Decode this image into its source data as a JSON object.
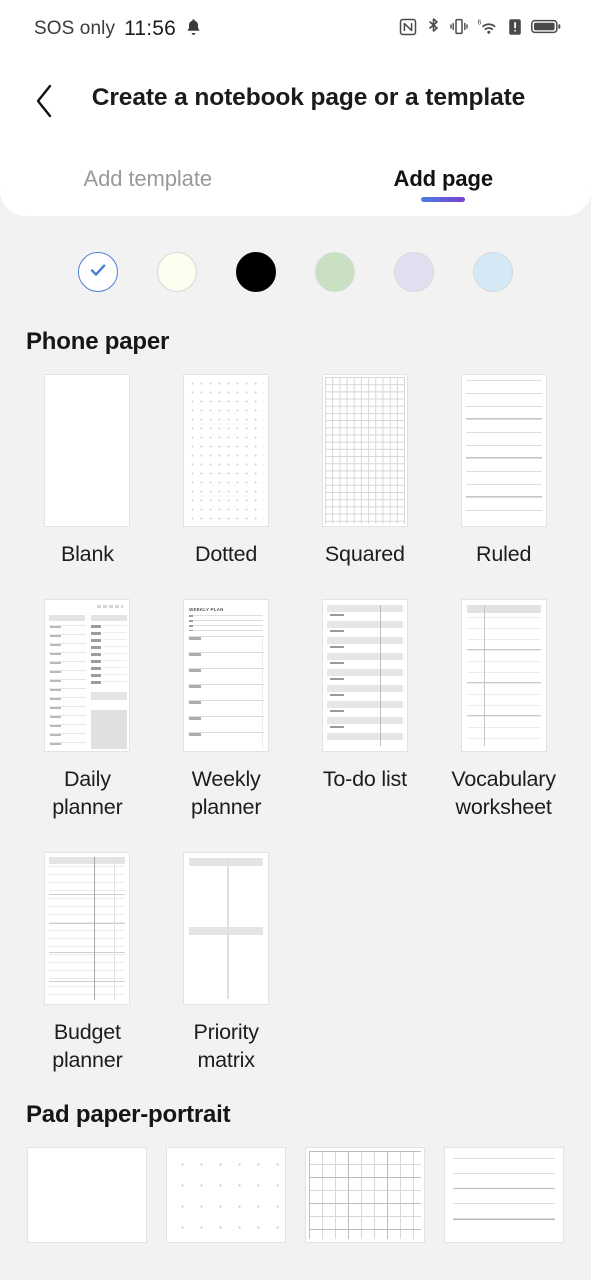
{
  "statusbar": {
    "carrier": "SOS only",
    "time": "11:56",
    "icons_left": [
      "bell-icon"
    ],
    "icons_right": [
      "nfc-icon",
      "bluetooth-icon",
      "vibrate-icon",
      "wifi6-icon",
      "sim-alert-icon",
      "battery-icon"
    ]
  },
  "header": {
    "back_icon": "chevron-left-icon",
    "title": "Create a notebook page or a template",
    "tabs": [
      {
        "label": "Add template",
        "active": false
      },
      {
        "label": "Add page",
        "active": true
      }
    ],
    "active_underline_gradient": [
      "#4a7fe0",
      "#7a3fd0"
    ]
  },
  "colors": {
    "accent_blue": "#4a7fd4",
    "background": "#f2f2f2",
    "card": "#ffffff"
  },
  "swatches": [
    {
      "name": "white",
      "hex": "#ffffff",
      "selected": true
    },
    {
      "name": "ivory",
      "hex": "#fdfdf0",
      "selected": false
    },
    {
      "name": "black",
      "hex": "#000000",
      "selected": false
    },
    {
      "name": "sage-green",
      "hex": "#c9e0c3",
      "selected": false
    },
    {
      "name": "lavender",
      "hex": "#e2dff0",
      "selected": false
    },
    {
      "name": "light-blue",
      "hex": "#d5e8f5",
      "selected": false
    }
  ],
  "sections": [
    {
      "title": "Phone paper",
      "items": [
        {
          "label": "Blank",
          "pattern": "blank"
        },
        {
          "label": "Dotted",
          "pattern": "dotted"
        },
        {
          "label": "Squared",
          "pattern": "squared"
        },
        {
          "label": "Ruled",
          "pattern": "ruled"
        },
        {
          "label": "Daily planner",
          "pattern": "daily-planner"
        },
        {
          "label": "Weekly planner",
          "pattern": "weekly-planner",
          "thumb_text": "WEEKLY PLAN"
        },
        {
          "label": "To-do list",
          "pattern": "todo-list"
        },
        {
          "label": "Vocabulary worksheet",
          "pattern": "vocabulary"
        },
        {
          "label": "Budget planner",
          "pattern": "budget-planner"
        },
        {
          "label": "Priority matrix",
          "pattern": "priority-matrix"
        }
      ]
    },
    {
      "title": "Pad paper-portrait",
      "items": [
        {
          "label": "",
          "pattern": "pad-blank"
        },
        {
          "label": "",
          "pattern": "pad-dotted"
        },
        {
          "label": "",
          "pattern": "pad-squared"
        },
        {
          "label": "",
          "pattern": "pad-ruled"
        }
      ]
    }
  ]
}
